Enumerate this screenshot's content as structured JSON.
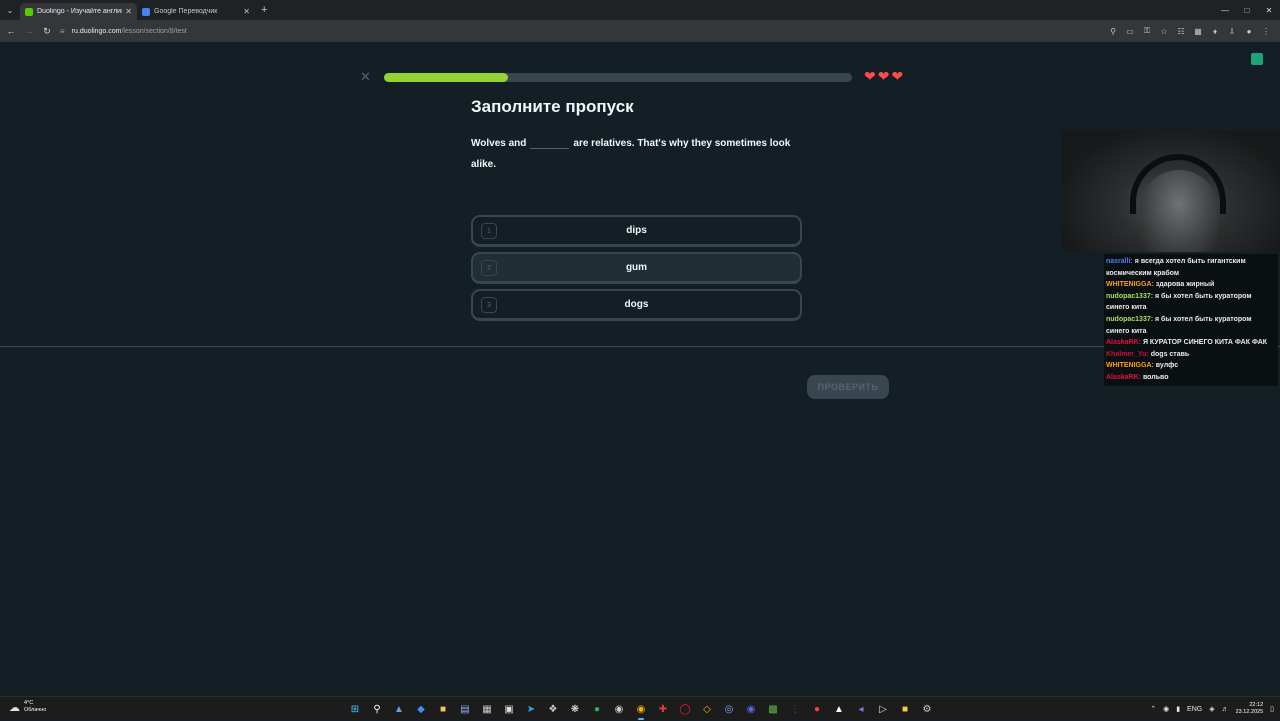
{
  "browser": {
    "tabs": [
      {
        "title": "Duolingo - Изучайте английск",
        "favicon_color": "#58cc02",
        "active": true
      },
      {
        "title": "Google Переводчик",
        "favicon_color": "#4285f4",
        "active": false
      }
    ],
    "url_host": "ru.duolingo.com",
    "url_path": "/lesson/section/8/test"
  },
  "lesson": {
    "progress_fraction": 0.265,
    "hearts": 3,
    "heading": "Заполните пропуск",
    "sentence_before": "Wolves and",
    "sentence_after": "are relatives. That's why they sometimes look alike.",
    "choices": [
      {
        "num": "1",
        "word": "dips"
      },
      {
        "num": "2",
        "word": "gum"
      },
      {
        "num": "3",
        "word": "dogs"
      }
    ],
    "check_label": "ПРОВЕРИТЬ"
  },
  "chat": [
    {
      "user": "nasralli:",
      "color": "#4a7dff",
      "text": "я всегда хотел быть гигантским космическим крабом"
    },
    {
      "user": "WHITENIGGA:",
      "color": "#ff9f1a",
      "text": "здарова жирный"
    },
    {
      "user": "nudopac1337:",
      "color": "#a8e05f",
      "text": "я бы хотел быть куратором синего кита"
    },
    {
      "user": "nudopac1337:",
      "color": "#a8e05f",
      "text": "я бы хотел быть куратором синего кита"
    },
    {
      "user": "AlaskaRK:",
      "color": "#e0143c",
      "text": "Я КУРАТОР СИНЕГО КИТА ФАК ФАК"
    },
    {
      "user": "Khalmer_Yu:",
      "color": "#c0143c",
      "text": "dogs ставь"
    },
    {
      "user": "WHITENIGGA:",
      "color": "#ff9f1a",
      "text": "вулфс"
    },
    {
      "user": "AlaskaRK:",
      "color": "#e0143c",
      "text": "вольво"
    }
  ],
  "taskbar": {
    "temperature": "4°C",
    "weather": "Облачно",
    "lang": "ENG",
    "time": "22:12",
    "date": "23.12.2025"
  }
}
